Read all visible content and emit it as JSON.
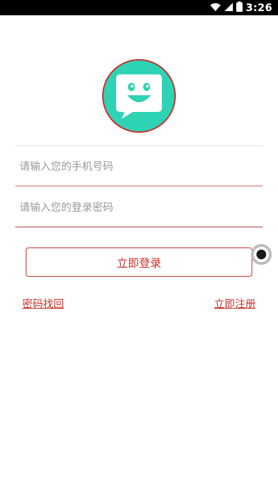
{
  "status_bar": {
    "time": "3:26",
    "icons": [
      "wifi-icon",
      "signal-icon",
      "battery-icon"
    ]
  },
  "logo": {
    "icon": "smiley-chat-bubble-icon",
    "bg_color": "#2ed3b3",
    "ring_color": "#c9302c"
  },
  "form": {
    "phone_placeholder": "请输入您的手机号码",
    "password_placeholder": "请输入您的登录密码",
    "login_label": "立即登录"
  },
  "links": {
    "forgot_password": "密码找回",
    "register": "立即注册"
  },
  "colors": {
    "accent": "#c9302c",
    "placeholder": "#9a9a9a"
  }
}
